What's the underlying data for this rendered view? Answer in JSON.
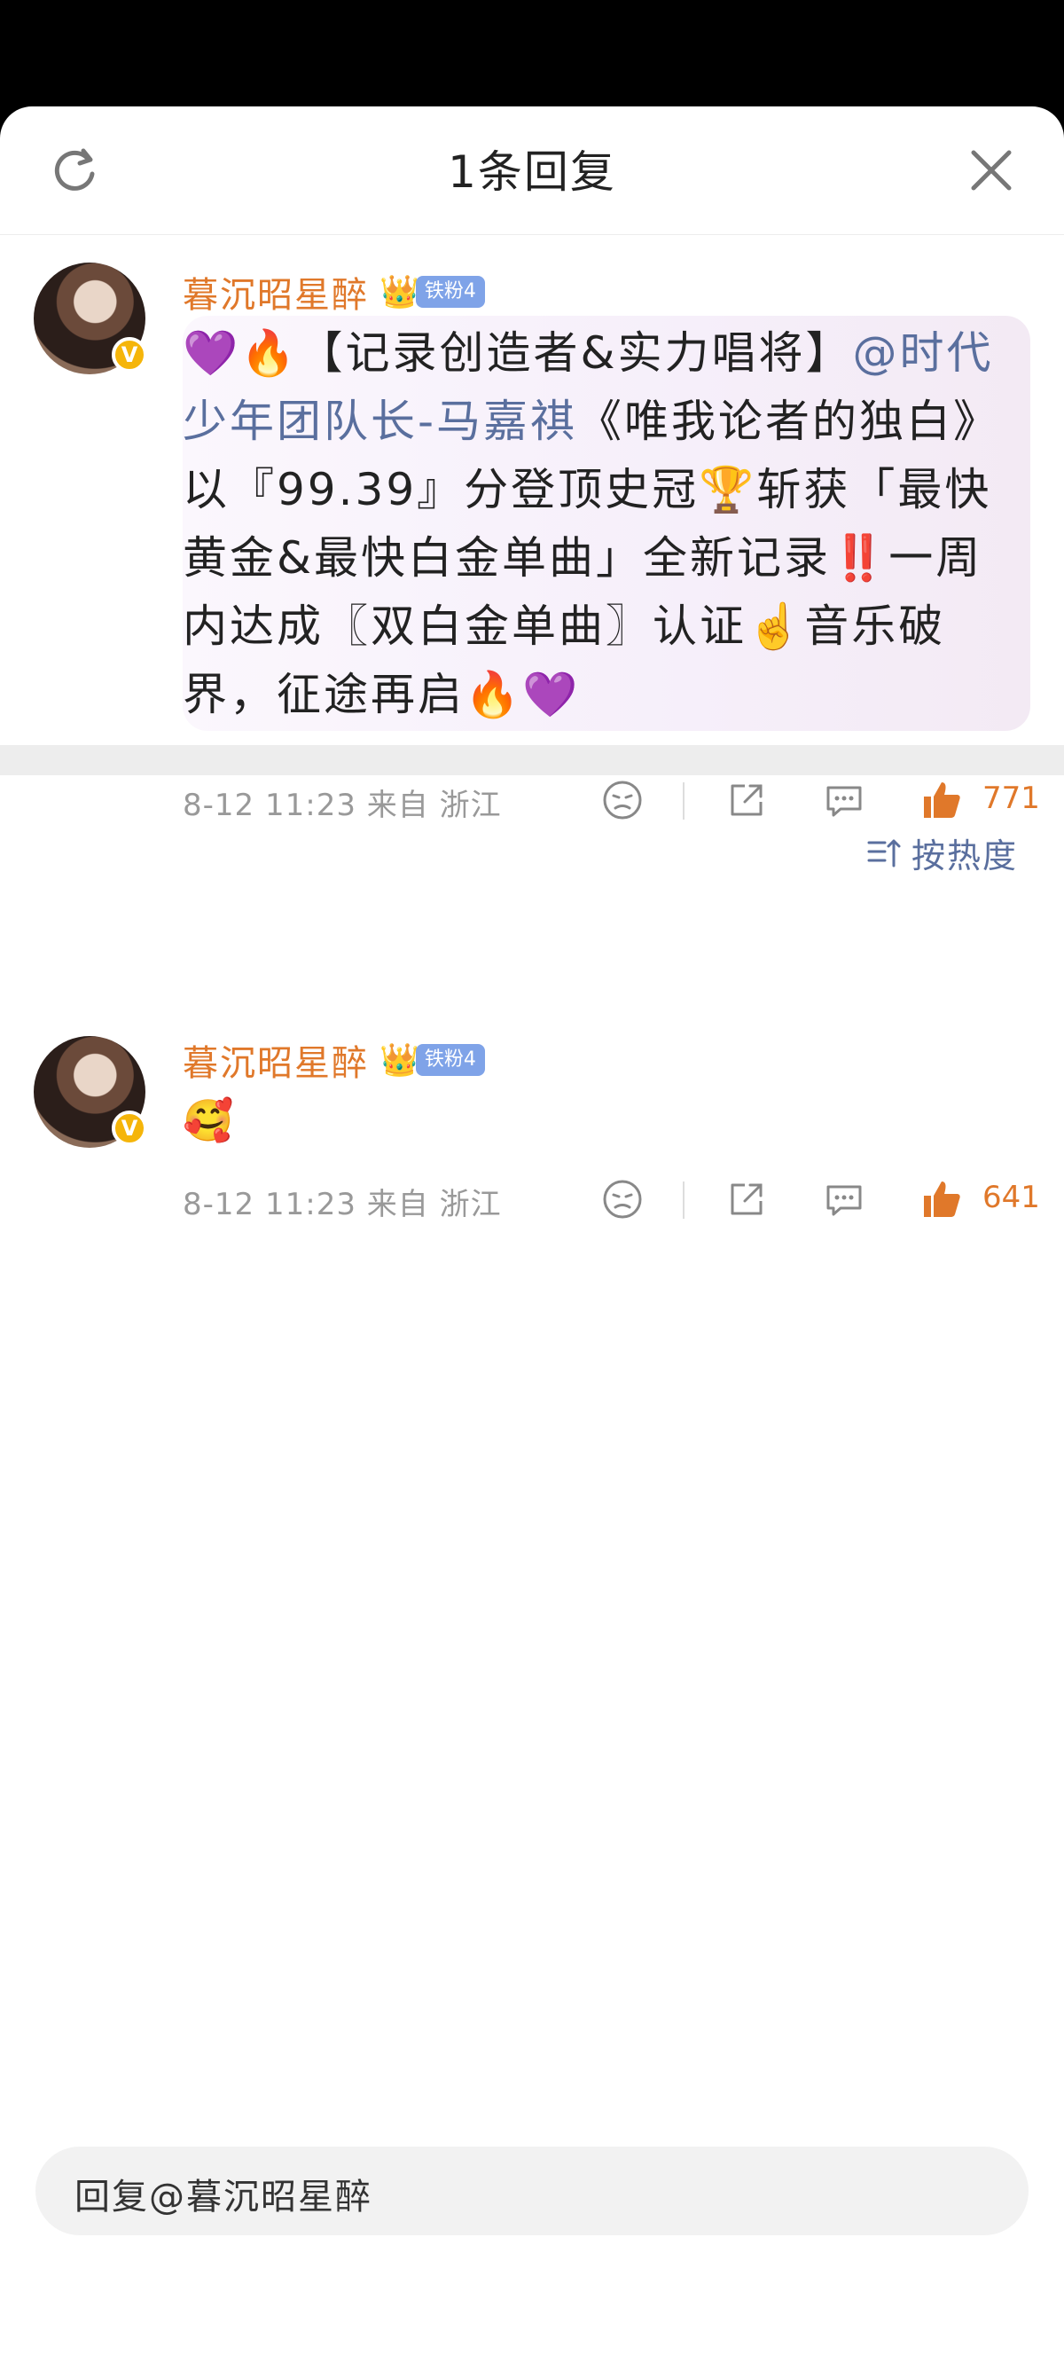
{
  "header": {
    "title": "1条回复",
    "refresh_icon": "refresh-icon",
    "close_icon": "close-icon"
  },
  "root_comment": {
    "username": "暮沉昭星醉",
    "fan_badge": "铁粉4",
    "crown": "👑",
    "verified": "V",
    "text_prefix": "💜🔥【记录创造者&实力唱将】",
    "mention": "@时代少年团队长-马嘉祺",
    "text_suffix": "《唯我论者的独白》以『99.39』分登顶史冠🏆斩获「最快黄金&最快白金单曲」全新记录‼️一周内达成〖双白金单曲〗认证☝️音乐破界，征途再启🔥💜",
    "time": "8-12 11:23",
    "location": "来自 浙江",
    "likes": "771"
  },
  "sort": {
    "label": "按热度",
    "icon": "sort-icon"
  },
  "reply": {
    "username": "暮沉昭星醉",
    "fan_badge": "铁粉4",
    "crown": "👑",
    "verified": "V",
    "text": "🥰",
    "time": "8-12 11:23",
    "location": "来自 浙江",
    "likes": "641"
  },
  "reply_bar": {
    "placeholder": "回复@暮沉昭星醉"
  },
  "colors": {
    "accent_orange": "#e0782a",
    "mention_blue": "#5a6f9e",
    "fan_badge_blue": "#7fa3e8",
    "verified_gold": "#f5b50a"
  }
}
